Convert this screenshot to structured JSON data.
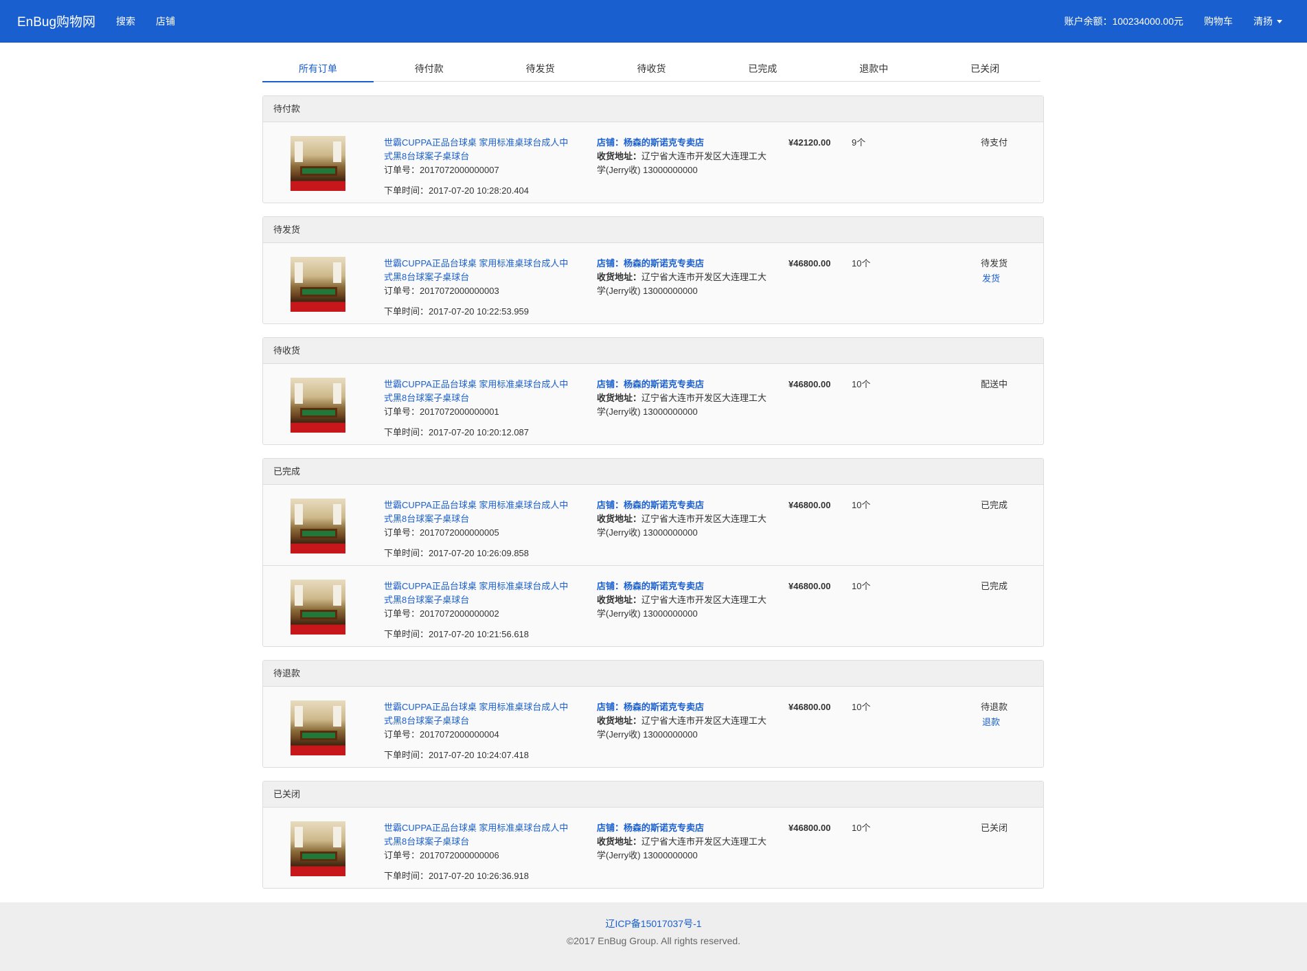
{
  "navbar": {
    "brand": "EnBug购物网",
    "links": [
      "搜索",
      "店铺"
    ],
    "balance": "账户余额：100234000.00元",
    "cart": "购物车",
    "user": "清扬"
  },
  "tabs": [
    "所有订单",
    "待付款",
    "待发货",
    "待收货",
    "已完成",
    "退款中",
    "已关闭"
  ],
  "groups": [
    {
      "heading": "待付款",
      "orders": [
        {
          "title": "世霸CUPPA正品台球桌 家用标准桌球台成人中式黑8台球案子桌球台",
          "orderno": "订单号：2017072000000007",
          "time": "下单时间：2017-07-20 10:28:20.404",
          "shop": "店铺：杨森的斯诺克专卖店",
          "address_label": "收货地址：",
          "address": "辽宁省大连市开发区大连理工大学(Jerry收) 13000000000",
          "price": "¥42120.00",
          "qty": "9个",
          "status": "待支付",
          "action": ""
        }
      ]
    },
    {
      "heading": "待发货",
      "orders": [
        {
          "title": "世霸CUPPA正品台球桌 家用标准桌球台成人中式黑8台球案子桌球台",
          "orderno": "订单号：2017072000000003",
          "time": "下单时间：2017-07-20 10:22:53.959",
          "shop": "店铺：杨森的斯诺克专卖店",
          "address_label": "收货地址：",
          "address": "辽宁省大连市开发区大连理工大学(Jerry收) 13000000000",
          "price": "¥46800.00",
          "qty": "10个",
          "status": "待发货",
          "action": "发货"
        }
      ]
    },
    {
      "heading": "待收货",
      "orders": [
        {
          "title": "世霸CUPPA正品台球桌 家用标准桌球台成人中式黑8台球案子桌球台",
          "orderno": "订单号：2017072000000001",
          "time": "下单时间：2017-07-20 10:20:12.087",
          "shop": "店铺：杨森的斯诺克专卖店",
          "address_label": "收货地址：",
          "address": "辽宁省大连市开发区大连理工大学(Jerry收) 13000000000",
          "price": "¥46800.00",
          "qty": "10个",
          "status": "配送中",
          "action": ""
        }
      ]
    },
    {
      "heading": "已完成",
      "orders": [
        {
          "title": "世霸CUPPA正品台球桌 家用标准桌球台成人中式黑8台球案子桌球台",
          "orderno": "订单号：2017072000000005",
          "time": "下单时间：2017-07-20 10:26:09.858",
          "shop": "店铺：杨森的斯诺克专卖店",
          "address_label": "收货地址：",
          "address": "辽宁省大连市开发区大连理工大学(Jerry收) 13000000000",
          "price": "¥46800.00",
          "qty": "10个",
          "status": "已完成",
          "action": ""
        },
        {
          "title": "世霸CUPPA正品台球桌 家用标准桌球台成人中式黑8台球案子桌球台",
          "orderno": "订单号：2017072000000002",
          "time": "下单时间：2017-07-20 10:21:56.618",
          "shop": "店铺：杨森的斯诺克专卖店",
          "address_label": "收货地址：",
          "address": "辽宁省大连市开发区大连理工大学(Jerry收) 13000000000",
          "price": "¥46800.00",
          "qty": "10个",
          "status": "已完成",
          "action": ""
        }
      ]
    },
    {
      "heading": "待退款",
      "orders": [
        {
          "title": "世霸CUPPA正品台球桌 家用标准桌球台成人中式黑8台球案子桌球台",
          "orderno": "订单号：2017072000000004",
          "time": "下单时间：2017-07-20 10:24:07.418",
          "shop": "店铺：杨森的斯诺克专卖店",
          "address_label": "收货地址：",
          "address": "辽宁省大连市开发区大连理工大学(Jerry收) 13000000000",
          "price": "¥46800.00",
          "qty": "10个",
          "status": "待退款",
          "action": "退款"
        }
      ]
    },
    {
      "heading": "已关闭",
      "orders": [
        {
          "title": "世霸CUPPA正品台球桌 家用标准桌球台成人中式黑8台球案子桌球台",
          "orderno": "订单号：2017072000000006",
          "time": "下单时间：2017-07-20 10:26:36.918",
          "shop": "店铺：杨森的斯诺克专卖店",
          "address_label": "收货地址：",
          "address": "辽宁省大连市开发区大连理工大学(Jerry收) 13000000000",
          "price": "¥46800.00",
          "qty": "10个",
          "status": "已关闭",
          "action": ""
        }
      ]
    }
  ],
  "footer": {
    "icp": "辽ICP备15017037号-1",
    "copyright": "©2017 EnBug Group. All rights reserved."
  }
}
